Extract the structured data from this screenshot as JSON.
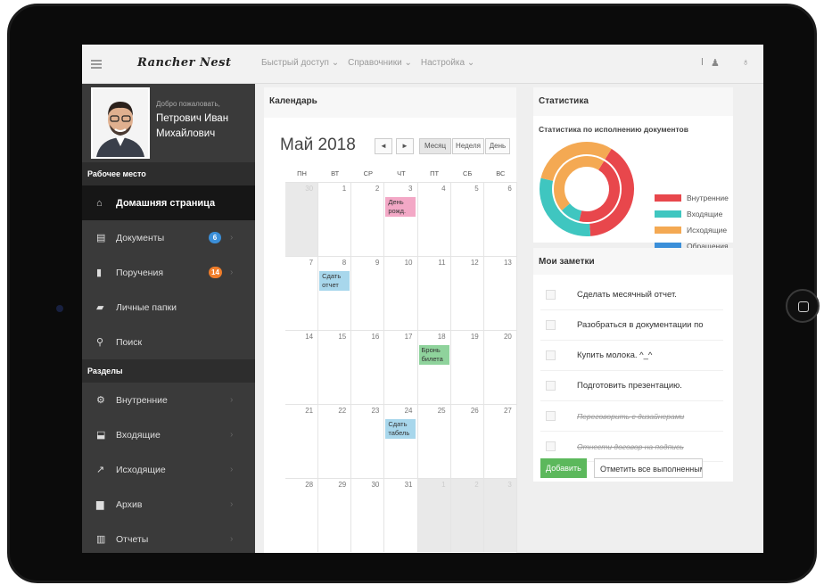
{
  "app": {
    "logo": "Rancher Nest"
  },
  "topnav": [
    "Быстрый доступ ⌄",
    "Справочники ⌄",
    "Настройка ⌄"
  ],
  "profile": {
    "welcome": "Добро пожаловать,",
    "name": "Петрович Иван Михайлович"
  },
  "sidebar": {
    "workspace_title": "Рабочее место",
    "workspace": [
      {
        "label": "Домашняя страница",
        "icon": "home-icon",
        "glyph": "⌂"
      },
      {
        "label": "Документы",
        "icon": "document-icon",
        "glyph": "▤",
        "badge": "6",
        "badge_color": "#3b8fd9"
      },
      {
        "label": "Поручения",
        "icon": "bookmark-icon",
        "glyph": "▮",
        "badge": "14",
        "badge_color": "#ef7d2a"
      },
      {
        "label": "Личные папки",
        "icon": "folder-icon",
        "glyph": "▰"
      },
      {
        "label": "Поиск",
        "icon": "search-icon",
        "glyph": "⚲"
      }
    ],
    "sections_title": "Разделы",
    "sections": [
      {
        "label": "Внутренние",
        "icon": "gears-icon",
        "glyph": "⚙"
      },
      {
        "label": "Входящие",
        "icon": "inbox-icon",
        "glyph": "⬓"
      },
      {
        "label": "Исходящие",
        "icon": "external-link-icon",
        "glyph": "↗"
      },
      {
        "label": "Архив",
        "icon": "archive-icon",
        "glyph": "▆"
      },
      {
        "label": "Отчеты",
        "icon": "bar-chart-icon",
        "glyph": "▥"
      }
    ]
  },
  "calendar": {
    "panel_title": "Календарь",
    "title": "Май 2018",
    "prev": "◄",
    "next": "►",
    "views": [
      "Месяц",
      "Неделя",
      "День"
    ],
    "weekdays": [
      "ПН",
      "ВТ",
      "СР",
      "ЧТ",
      "ПТ",
      "СБ",
      "ВС"
    ],
    "weeks": [
      [
        "30",
        "1",
        "2",
        "3",
        "4",
        "5",
        "6"
      ],
      [
        "7",
        "8",
        "9",
        "10",
        "11",
        "12",
        "13"
      ],
      [
        "14",
        "15",
        "16",
        "17",
        "18",
        "19",
        "20"
      ],
      [
        "21",
        "22",
        "23",
        "24",
        "25",
        "26",
        "27"
      ],
      [
        "28",
        "29",
        "30",
        "31",
        "1",
        "2",
        "3"
      ]
    ],
    "events": [
      {
        "week": 0,
        "day": 3,
        "text": "День рожд.",
        "color": "#f3a8c6"
      },
      {
        "week": 1,
        "day": 1,
        "text": "Сдать отчет",
        "color": "#a8d7ec"
      },
      {
        "week": 2,
        "day": 4,
        "text": "Бронь билета",
        "color": "#8fd39c"
      },
      {
        "week": 3,
        "day": 3,
        "text": "Сдать табель",
        "color": "#a8d7ec"
      }
    ]
  },
  "stats": {
    "panel_title": "Статистика",
    "chart_title": "Статистика по исполнению документов",
    "chart_data": {
      "type": "pie",
      "title": "Статистика по исполнению документов",
      "series": [
        {
          "ring": "outer",
          "values": [
            40,
            30,
            30
          ],
          "labels": [
            "Внутренние",
            "Входящие",
            "Исходящие"
          ]
        },
        {
          "ring": "inner",
          "values": [
            45,
            10,
            45
          ],
          "labels": [
            "Внутренние",
            "Входящие",
            "Исходящие"
          ]
        }
      ],
      "legend": [
        {
          "name": "Внутренние",
          "color": "#e8474c"
        },
        {
          "name": "Входящие",
          "color": "#3fc6c0"
        },
        {
          "name": "Исходящие",
          "color": "#f4a953"
        },
        {
          "name": "Обращения",
          "color": "#3b8fd9"
        }
      ],
      "legend_position": "right"
    }
  },
  "notes": {
    "panel_title": "Мои заметки",
    "items": [
      {
        "text": "Сделать месячный отчет.",
        "done": false
      },
      {
        "text": "Разобраться в документации по",
        "done": false
      },
      {
        "text": "Купить молока. ^_^",
        "done": false
      },
      {
        "text": "Подготовить презентацию.",
        "done": false
      },
      {
        "text": "Переговорить с дизайнерами",
        "done": true
      },
      {
        "text": "Отнести договор на подпись",
        "done": true
      }
    ],
    "add_label": "Добавить",
    "mark_all_label": "Отметить все выполненными"
  }
}
